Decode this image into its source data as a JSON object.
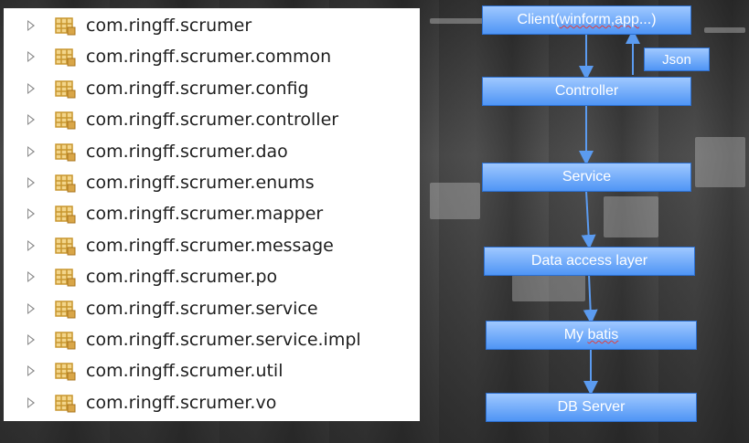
{
  "packages": [
    "com.ringff.scrumer",
    "com.ringff.scrumer.common",
    "com.ringff.scrumer.config",
    "com.ringff.scrumer.controller",
    "com.ringff.scrumer.dao",
    "com.ringff.scrumer.enums",
    "com.ringff.scrumer.mapper",
    "com.ringff.scrumer.message",
    "com.ringff.scrumer.po",
    "com.ringff.scrumer.service",
    "com.ringff.scrumer.service.impl",
    "com.ringff.scrumer.util",
    "com.ringff.scrumer.vo"
  ],
  "diagram": {
    "client": {
      "prefix": "Client(",
      "underlined": "winform,app",
      "suffix": "...)"
    },
    "json": "Json",
    "controller": "Controller",
    "service": "Service",
    "data_access": "Data access layer",
    "mybatis": {
      "prefix": "My ",
      "underlined": "batis"
    },
    "db_server": "DB Server"
  },
  "colors": {
    "box_top": "#9fc8ff",
    "box_bottom": "#4f95f5",
    "arrow": "#5b9bf0",
    "package_icon": "#c8962e"
  }
}
